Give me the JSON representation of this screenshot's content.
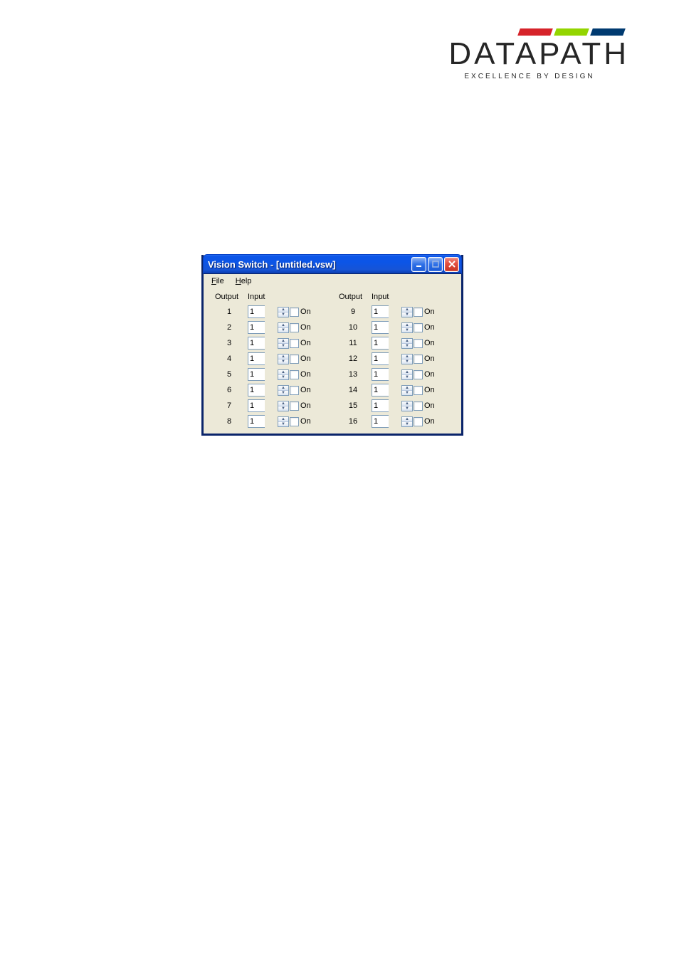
{
  "logo": {
    "brand": "DATAPATH",
    "tagline": "EXCELLENCE BY DESIGN"
  },
  "window": {
    "title": "Vision Switch - [untitled.vsw]",
    "menu": {
      "file": "File",
      "help": "Help"
    },
    "headers": {
      "output": "Output",
      "input": "Input"
    },
    "on_label": "On",
    "rows_left": [
      {
        "output": "1",
        "input": "1"
      },
      {
        "output": "2",
        "input": "1"
      },
      {
        "output": "3",
        "input": "1"
      },
      {
        "output": "4",
        "input": "1"
      },
      {
        "output": "5",
        "input": "1"
      },
      {
        "output": "6",
        "input": "1"
      },
      {
        "output": "7",
        "input": "1"
      },
      {
        "output": "8",
        "input": "1"
      }
    ],
    "rows_right": [
      {
        "output": "9",
        "input": "1"
      },
      {
        "output": "10",
        "input": "1"
      },
      {
        "output": "11",
        "input": "1"
      },
      {
        "output": "12",
        "input": "1"
      },
      {
        "output": "13",
        "input": "1"
      },
      {
        "output": "14",
        "input": "1"
      },
      {
        "output": "15",
        "input": "1"
      },
      {
        "output": "16",
        "input": "1"
      }
    ]
  }
}
